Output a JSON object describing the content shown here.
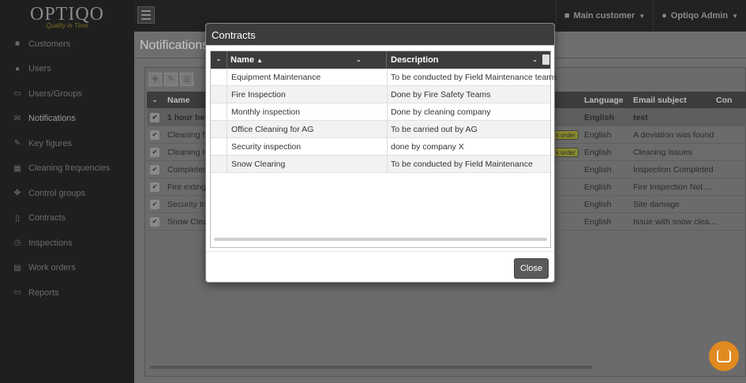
{
  "logo": {
    "text": "OPTIQO",
    "tagline": "Quality in Time"
  },
  "sidebar": {
    "items": [
      {
        "label": "Customers",
        "icon": "briefcase-icon"
      },
      {
        "label": "Users",
        "icon": "users-icon"
      },
      {
        "label": "Users/Groups",
        "icon": "id-card-icon"
      },
      {
        "label": "Notifications",
        "icon": "envelope-icon"
      },
      {
        "label": "Key figures",
        "icon": "pen-icon"
      },
      {
        "label": "Cleaning frequencies",
        "icon": "calculator-icon"
      },
      {
        "label": "Control groups",
        "icon": "group-icon"
      },
      {
        "label": "Contracts",
        "icon": "document-icon"
      },
      {
        "label": "Inspections",
        "icon": "clock-icon"
      },
      {
        "label": "Work orders",
        "icon": "list-icon"
      },
      {
        "label": "Reports",
        "icon": "monitor-icon"
      }
    ]
  },
  "topbar": {
    "customer": "Main customer",
    "user": "Optiqo Admin"
  },
  "page": {
    "title": "Notifications"
  },
  "bg_table": {
    "headers": {
      "name": "Name",
      "language": "Language",
      "email_subject": "Email subject",
      "con": "Con"
    },
    "badge": "k order",
    "rows": [
      {
        "name": "1 hour bef",
        "language": "English",
        "subject": "test"
      },
      {
        "name": "Cleaning fr",
        "language": "English",
        "subject": "A deviation was found"
      },
      {
        "name": "Cleaning Is",
        "language": "English",
        "subject": "Cleaning Issues"
      },
      {
        "name": "Completed",
        "language": "English",
        "subject": "Inspection Completed"
      },
      {
        "name": "Fire exting",
        "language": "English",
        "subject": "Fire Inspection Not ..."
      },
      {
        "name": "Security Ins",
        "language": "English",
        "subject": "Site damage"
      },
      {
        "name": "Snow Clea",
        "language": "English",
        "subject": "Issue with snow clea..."
      }
    ]
  },
  "modal": {
    "title": "Contracts",
    "columns": {
      "name": "Name",
      "description": "Description"
    },
    "rows": [
      {
        "name": "Equipment Maintenance",
        "description": "To be conducted by Field Maintenance teams"
      },
      {
        "name": "Fire Inspection",
        "description": "Done by Fire Safety Teams"
      },
      {
        "name": "Monthly inspection",
        "description": "Done by cleaning company"
      },
      {
        "name": "Office Cleaning for AG",
        "description": "To be carried out by AG"
      },
      {
        "name": "Security inspection",
        "description": "done by company X"
      },
      {
        "name": "Snow Clearing",
        "description": "To be conducted by Field Maintenance"
      }
    ],
    "close_label": "Close"
  }
}
